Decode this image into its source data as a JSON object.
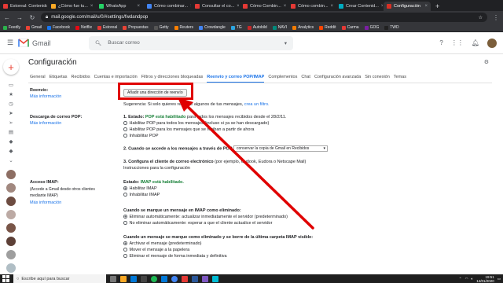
{
  "browser": {
    "tabs": [
      {
        "label": "Estoreal: Contenido",
        "color": "#e53935"
      },
      {
        "label": "¿Cómo fue tu...",
        "color": "#f9a825"
      },
      {
        "label": "WhatsApp",
        "color": "#25d366"
      },
      {
        "label": "Cómo combinar...",
        "color": "#4285f4"
      },
      {
        "label": "Consultar el co...",
        "color": "#e53935"
      },
      {
        "label": "Cómo Combin...",
        "color": "#e53935"
      },
      {
        "label": "Cómo combin...",
        "color": "#e53935"
      },
      {
        "label": "Crear Contenid...",
        "color": "#00acc1"
      },
      {
        "label": "Configuración",
        "color": "#d93025",
        "active": true
      }
    ],
    "url": "mail.google.com/mail/u/0/#settings/fwdandpop",
    "bookmarks": [
      "Feedly",
      "Gmail",
      "Facebook",
      "Netflix",
      "Estoreal",
      "Propuestas",
      "Getty",
      "Reuters",
      "Crowdangle",
      "TG",
      "Autobild",
      "NAVI",
      "Analytics",
      "Reddit",
      "Carma",
      "GOG",
      "TWD"
    ]
  },
  "gmail": {
    "app_name": "Gmail",
    "search_placeholder": "Buscar correo"
  },
  "settings": {
    "title": "Configuración",
    "tabs": [
      "General",
      "Etiquetas",
      "Recibidos",
      "Cuentas e importación",
      "Filtros y direcciones bloqueadas",
      "Reenvío y correo POP/IMAP",
      "Complementos",
      "Chat",
      "Configuración avanzada",
      "Sin conexión",
      "Temas"
    ],
    "forwarding": {
      "label": "Reenvío:",
      "more_info": "Más información",
      "button": "Añadir una dirección de reenvío",
      "tip_prefix": "Sugerencia: Si solo quieres reenviar algunos de tus mensajes,",
      "tip_link": "crea un filtro."
    },
    "pop": {
      "label": "Descarga de correo POP:",
      "more_info": "Más información",
      "status_prefix": "1. Estado:",
      "status_value": "POP está habilitado",
      "status_suffix": "para todos los mensajes recibidos desde el 28/2/11.",
      "opt1": "Habilitar POP para todos los mensajes (incluso si ya se han descargado)",
      "opt2": "Habilitar POP para los mensajes que se reciban a partir de ahora",
      "opt3": "Inhabilitar POP",
      "q2_text": "2. Cuando se accede a los mensajes a través de POP",
      "q2_select": "conservar la copia de Gmail en Recibidos",
      "q3_text": "3. Configura el cliente de correo electrónico",
      "q3_sub": "(por ejemplo, Outlook, Eudora o Netscape Mail)",
      "q3_link": "Instrucciones para la configuración"
    },
    "imap": {
      "label": "Acceso IMAP:",
      "desc": "(Accede a Gmail desde otros clientes mediante IMAP)",
      "more_info": "Más información",
      "status_prefix": "Estado:",
      "status_value": "IMAP está habilitado.",
      "opt_on": "Habilitar IMAP",
      "opt_off": "Inhabilitar IMAP",
      "del_title": "Cuando se marque un mensaje en IMAP como eliminado:",
      "del_opt1": "Eliminar automáticamente: actualizar inmediatamente el servidor (predeterminado)",
      "del_opt2": "No eliminar automáticamente: esperar a que el cliente actualice el servidor",
      "exp_title": "Cuando un mensaje se marque como eliminado y se borre de la última carpeta IMAP visible:",
      "exp_opt1": "Archivar el mensaje (predeterminado)",
      "exp_opt2": "Mover el mensaje a la papelera",
      "exp_opt3": "Eliminar el mensaje de forma inmediata y definitiva"
    }
  },
  "taskbar": {
    "search_placeholder": "Escribe aquí para buscar",
    "time": "19:51",
    "date": "14/01/2020"
  }
}
